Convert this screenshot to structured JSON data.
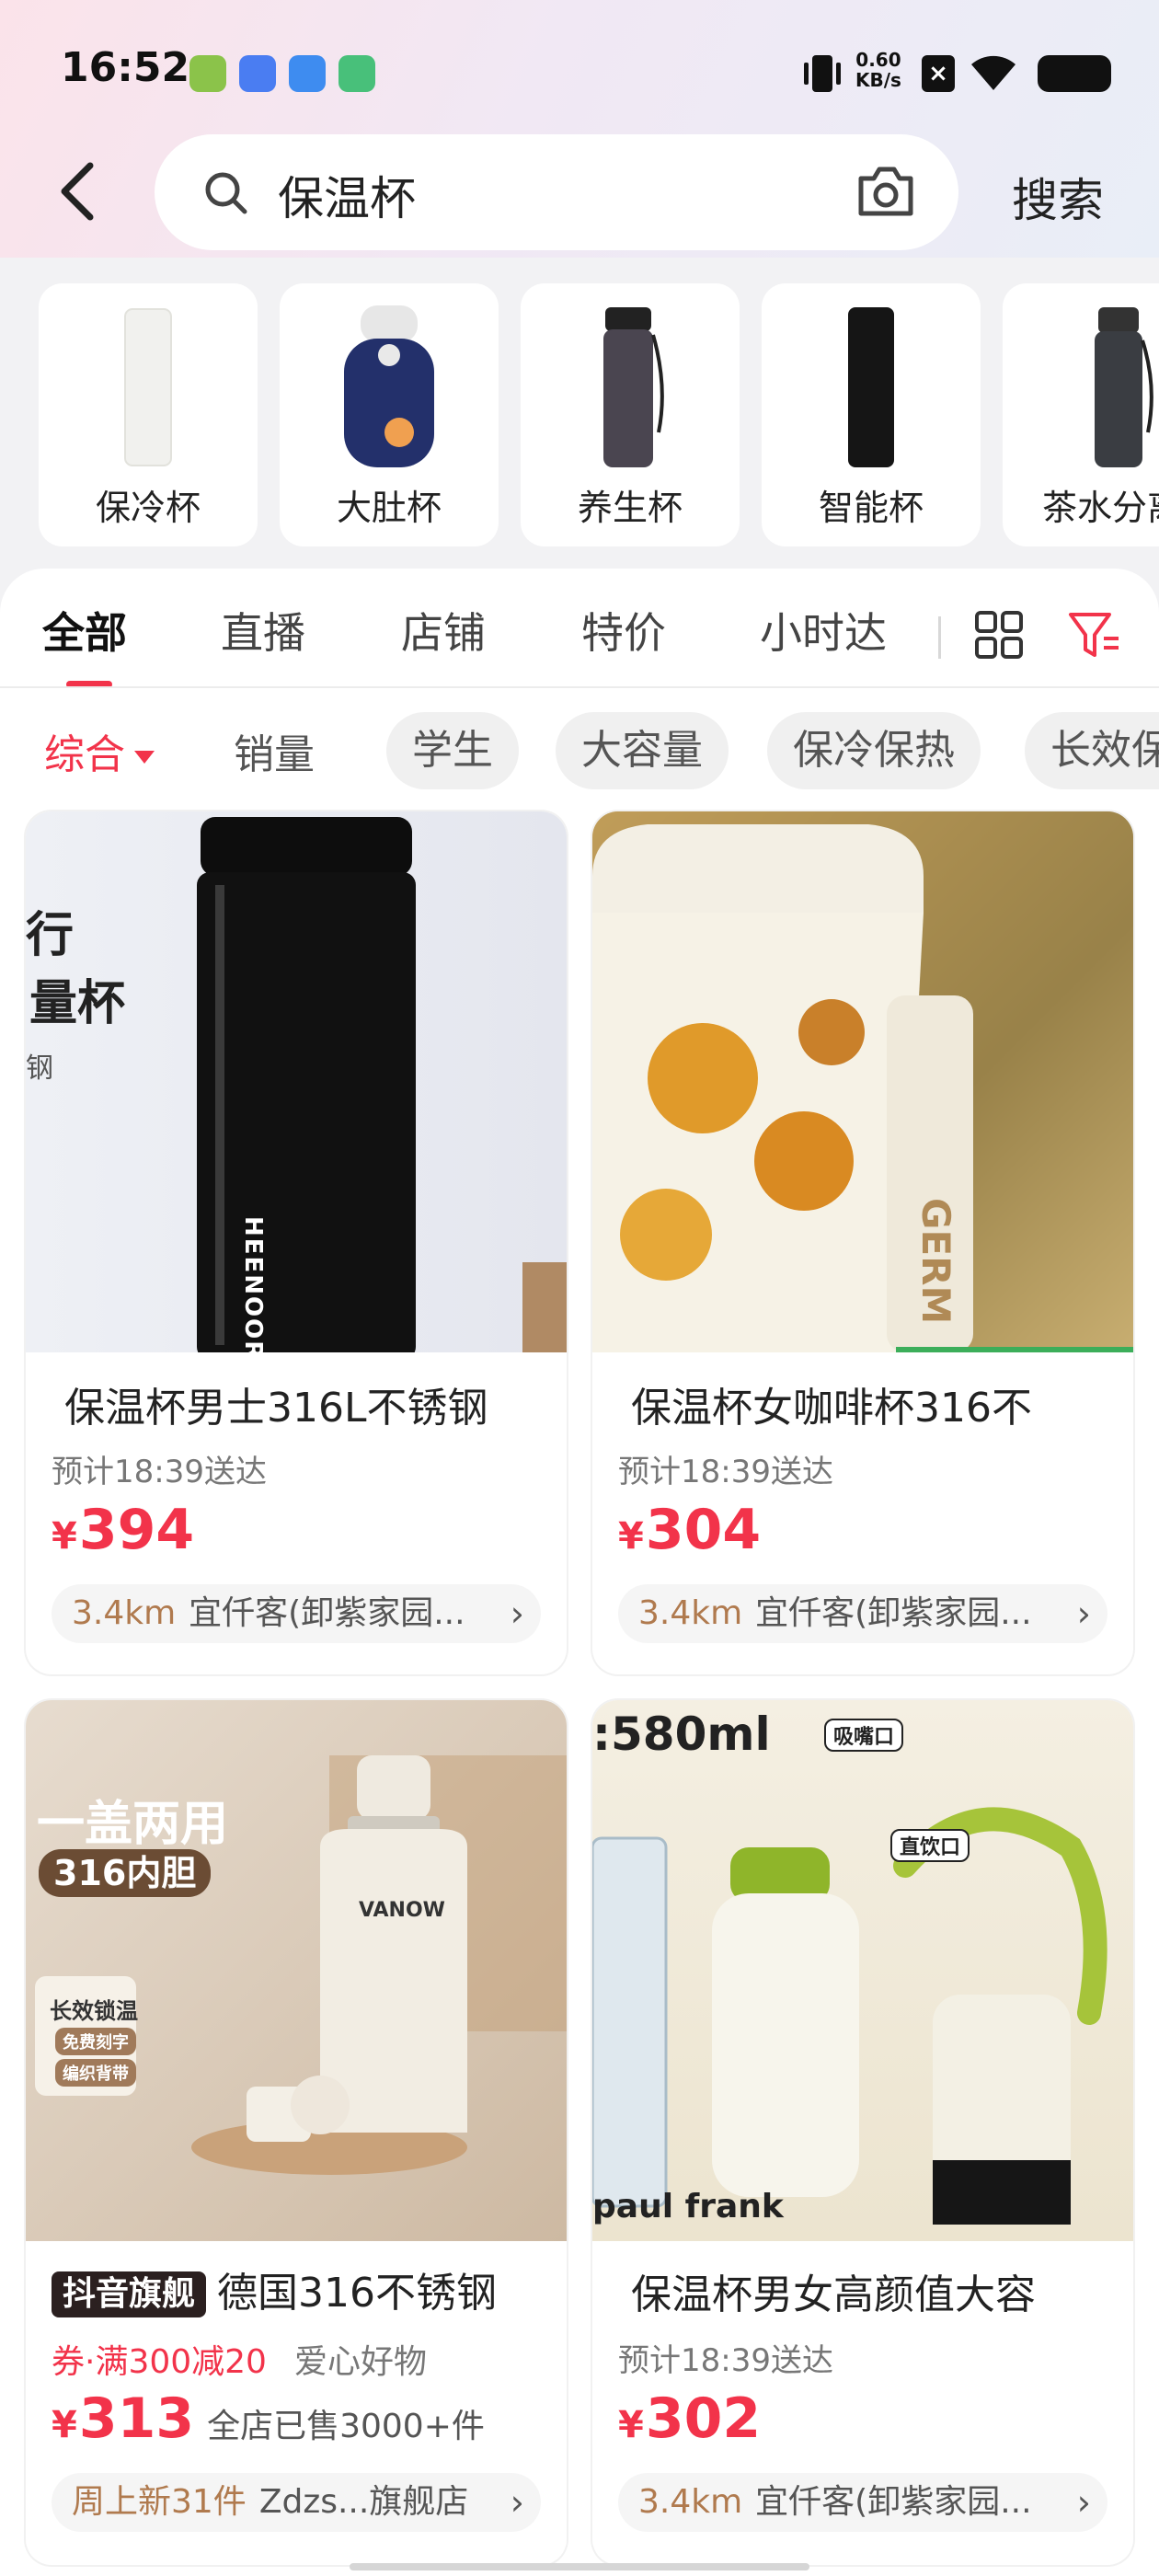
{
  "status_bar": {
    "time": "16:52",
    "net_speed_value": "0.60",
    "net_speed_unit": "KB/s"
  },
  "search": {
    "query": "保温杯",
    "button_label": "搜索"
  },
  "categories": [
    {
      "label": "保冷杯"
    },
    {
      "label": "大肚杯"
    },
    {
      "label": "养生杯"
    },
    {
      "label": "智能杯"
    },
    {
      "label": "茶水分离"
    }
  ],
  "tabs": [
    {
      "label": "全部",
      "active": true
    },
    {
      "label": "直播"
    },
    {
      "label": "店铺"
    },
    {
      "label": "特价"
    },
    {
      "label": "小时达"
    }
  ],
  "filters": {
    "sort_label": "综合",
    "sales_label": "销量",
    "chips": [
      "学生",
      "大容量",
      "保冷保热",
      "长效保"
    ]
  },
  "products": [
    {
      "title": "保温杯男士316L不锈钢",
      "eta": "预计18:39送达",
      "currency": "¥",
      "price": "394",
      "distance": "3.4km",
      "shop": "宜仟客(卸紫家园...",
      "image_text": [
        "行",
        "量杯",
        "钢"
      ],
      "brand_on_bottle": "HEENOOR"
    },
    {
      "title": "保温杯女咖啡杯316不",
      "eta": "预计18:39送达",
      "currency": "¥",
      "price": "304",
      "distance": "3.4km",
      "shop": "宜仟客(卸紫家园...",
      "image_text": [
        "GERM"
      ]
    },
    {
      "badge": "抖音旗舰",
      "title": "德国316不锈钢",
      "promo": "券·满300减20",
      "promo_extra": "爱心好物",
      "currency": "¥",
      "price": "313",
      "sold": "全店已售3000+件",
      "shop_tag": "周上新31件",
      "shop": "Zdzs...旗舰店",
      "image_text": [
        "一盖两用",
        "316内胆",
        "长效锁温",
        "免费刻字",
        "编织背带",
        "VANOW"
      ]
    },
    {
      "title": "保温杯男女高颜值大容",
      "eta": "预计18:39送达",
      "currency": "¥",
      "price": "302",
      "distance": "3.4km",
      "shop": "宜仟客(卸紫家园...",
      "image_text": [
        ":580ml",
        "吸嘴口",
        "直饮口",
        "paul frank"
      ]
    }
  ],
  "colors": {
    "accent": "#f2334a",
    "distance": "#b07a4e"
  }
}
